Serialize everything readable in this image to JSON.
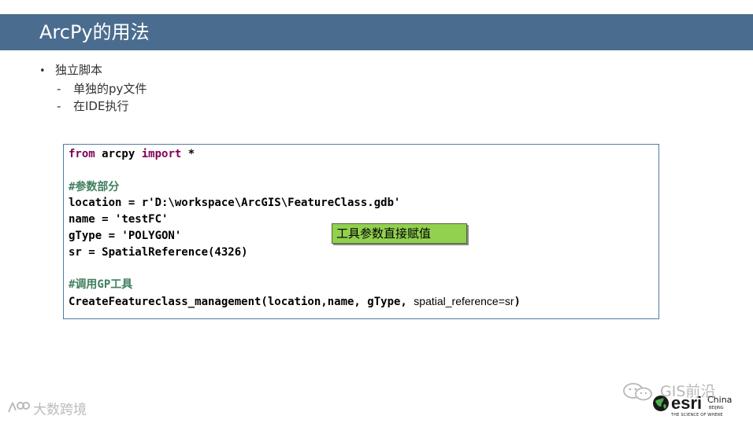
{
  "slide": {
    "title": "ArcPy的用法"
  },
  "bullets": {
    "main_marker": "•",
    "main": "独立脚本",
    "sub_marker": "-",
    "sub1": "单独的py文件",
    "sub2": "在IDE执行"
  },
  "code": {
    "l1_kw1": "from",
    "l1_mid": " arcpy ",
    "l1_kw2": "import",
    "l1_end": " *",
    "l3": "#参数部分",
    "l4": "location = r'D:\\workspace\\ArcGIS\\FeatureClass.gdb'",
    "l5": "name = 'testFC'",
    "l6": "gType = 'POLYGON'",
    "l7": "sr = SpatialReference(4326)",
    "l9": "#调用GP工具",
    "l10_a": "CreateFeatureclass_management(location,name, gType, ",
    "l10_b": "spatial_reference=sr",
    "l10_c": ")"
  },
  "callout": {
    "text": "工具参数直接赋值",
    "color": "#92d050"
  },
  "watermarks": {
    "left": "大数跨境",
    "right": "GIS前沿"
  },
  "esri_logo": {
    "word": "esri",
    "region": "China",
    "city": "BEIJING",
    "tagline": "THE SCIENCE OF WHERE"
  },
  "colors": {
    "title_bar": "#4a6d8f",
    "code_border": "#4f7da6",
    "keyword": "#7f0055",
    "comment": "#3f7f5f"
  }
}
